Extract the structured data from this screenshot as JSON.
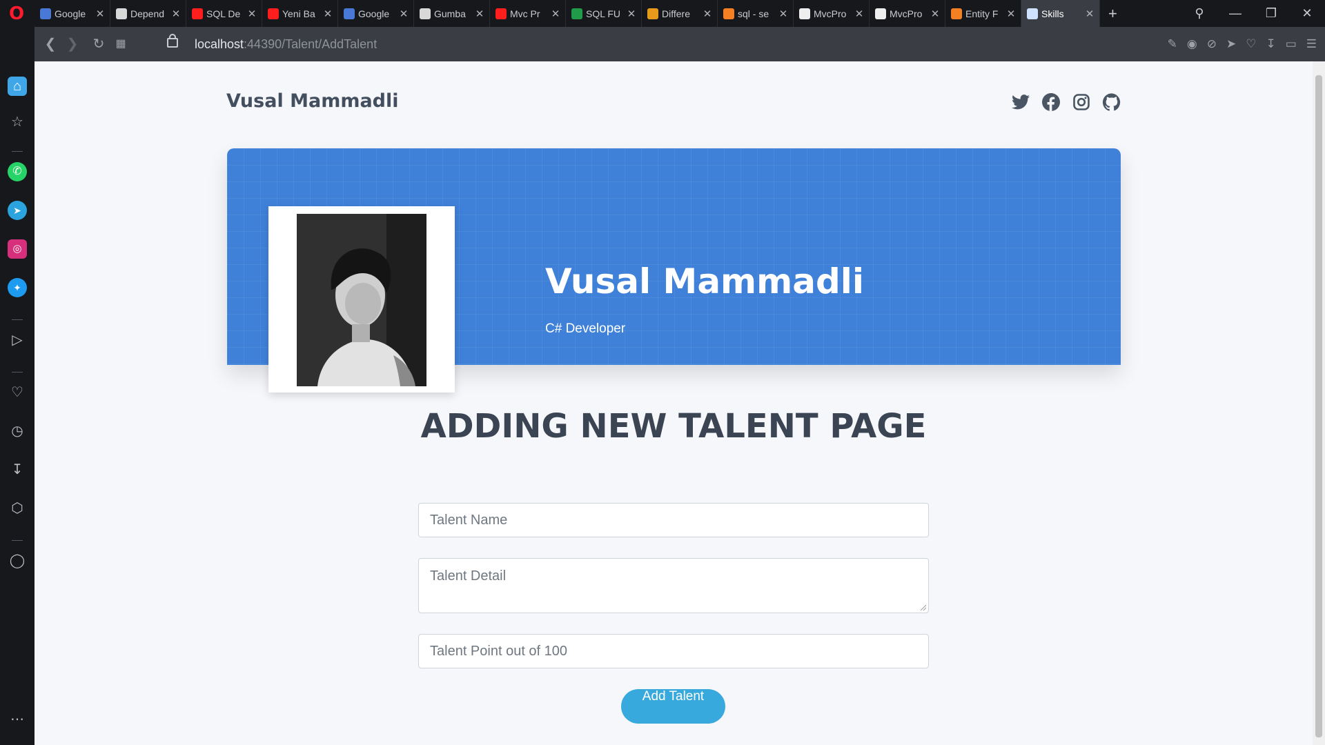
{
  "browser": {
    "tabs": [
      {
        "title": "Google",
        "color": "#4a78d6"
      },
      {
        "title": "Depend",
        "color": "#d8d8d8"
      },
      {
        "title": "SQL De",
        "color": "#ff1e1e"
      },
      {
        "title": "Yeni Ba",
        "color": "#ff1e1e"
      },
      {
        "title": "Google",
        "color": "#4a78d6"
      },
      {
        "title": "Gumba",
        "color": "#d8d8d8"
      },
      {
        "title": "Mvc Pr",
        "color": "#ff1e1e"
      },
      {
        "title": "SQL FU",
        "color": "#1f9b4a"
      },
      {
        "title": "Differe",
        "color": "#e89b1a"
      },
      {
        "title": "sql - se",
        "color": "#f48024"
      },
      {
        "title": "MvcPro",
        "color": "#eeeeee"
      },
      {
        "title": "MvcPro",
        "color": "#eeeeee"
      },
      {
        "title": "Entity F",
        "color": "#f48024"
      },
      {
        "title": "Skills",
        "color": "#cfe2ff"
      }
    ],
    "active_tab_index": 13,
    "url_host": "localhost",
    "url_rest": ":44390/Talent/AddTalent"
  },
  "site": {
    "brand": "Vusal Mammadli",
    "social_icons": [
      "twitter-icon",
      "facebook-icon",
      "instagram-icon",
      "github-icon"
    ]
  },
  "hero": {
    "name": "Vusal Mammadli",
    "role": "C# Developer",
    "accent_color": "#3f81d9"
  },
  "form": {
    "title": "ADDING NEW TALENT PAGE",
    "talent_name_placeholder": "Talent Name",
    "talent_detail_placeholder": "Talent Detail",
    "talent_point_placeholder": "Talent Point out of 100",
    "submit_label": "Add Talent",
    "button_color": "#37a9dc"
  }
}
